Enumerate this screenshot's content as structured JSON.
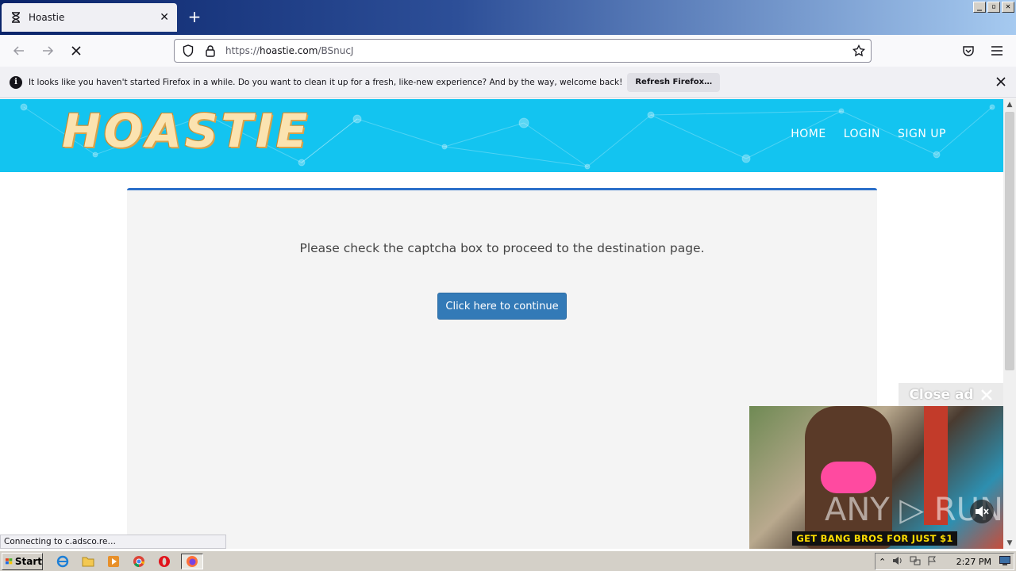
{
  "browser": {
    "tab_title": "Hoastie",
    "url_prefix": "https://",
    "url_domain": "hoastie.com",
    "url_path": "/BSnucJ",
    "window_controls": [
      "_",
      "▫",
      "✕"
    ]
  },
  "notification": {
    "message": "It looks like you haven't started Firefox in a while. Do you want to clean it up for a fresh, like-new experience? And by the way, welcome back!",
    "button_label": "Refresh Firefox…"
  },
  "site": {
    "logo": "HOASTIE",
    "nav": [
      "HOME",
      "LOGIN",
      "SIGN UP"
    ]
  },
  "panel": {
    "prompt": "Please check the captcha box to proceed to the destination page.",
    "button_label": "Click here to continue"
  },
  "ad": {
    "close_label": "Close ad",
    "banner_text": "GET BANG BROS FOR JUST $1",
    "watermark": "ANY ▷ RUN"
  },
  "status_text": "Connecting to c.adsco.re…",
  "taskbar": {
    "start_label": "Start",
    "clock": "2:27 PM"
  },
  "colors": {
    "header_bg": "#13c4f0",
    "panel_accent": "#2b6fc9",
    "button_bg": "#337ab7"
  }
}
